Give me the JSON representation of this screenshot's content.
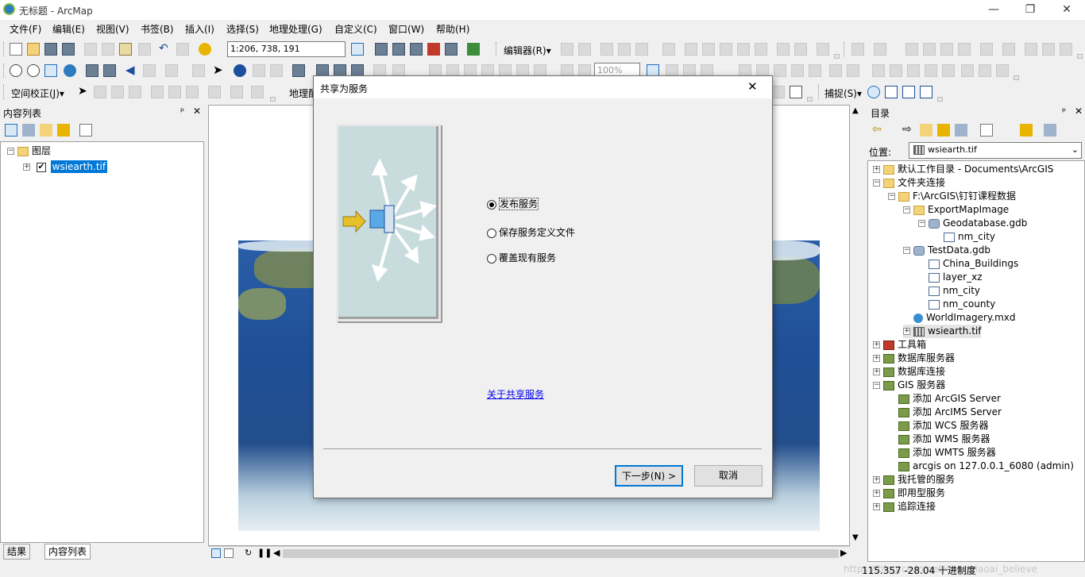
{
  "window": {
    "title": "无标题 - ArcMap",
    "minimize": "—",
    "maximize": "❐",
    "close": "✕"
  },
  "menu": [
    "文件(F)",
    "编辑(E)",
    "视图(V)",
    "书签(B)",
    "插入(I)",
    "选择(S)",
    "地理处理(G)",
    "自定义(C)",
    "窗口(W)",
    "帮助(H)"
  ],
  "toolbar": {
    "scale": "1:206, 738, 191",
    "editor_label": "编辑器(R)▾",
    "zoom_level": "100%",
    "georef_label": "空间校正(J)▾",
    "geoproc_label": "地理配",
    "snap_label": "捕捉(S)▾"
  },
  "toc": {
    "title": "内容列表",
    "pin": "ᵖ",
    "close": "✕",
    "layers_label": "图层",
    "layer_name": "wsiearth.tif",
    "tab_results": "结果",
    "tab_toc": "内容列表"
  },
  "dialog": {
    "title": "共享为服务",
    "close": "✕",
    "options": [
      {
        "label": "发布服务",
        "selected": true
      },
      {
        "label": "保存服务定义文件",
        "selected": false
      },
      {
        "label": "覆盖现有服务",
        "selected": false
      }
    ],
    "link": "关于共享服务",
    "next": "下一步(N) >",
    "cancel": "取消"
  },
  "catalog": {
    "title": "目录",
    "location_label": "位置:",
    "location_value": "wsiearth.tif",
    "tree": [
      {
        "label": "默认工作目录 - Documents\\ArcGIS",
        "icon": "folder",
        "indent": 0,
        "expander": "+"
      },
      {
        "label": "文件夹连接",
        "icon": "folder",
        "indent": 0,
        "expander": "−"
      },
      {
        "label": "F:\\ArcGIS\\钉钉课程数据",
        "icon": "folder",
        "indent": 1,
        "expander": "−"
      },
      {
        "label": "ExportMapImage",
        "icon": "folder",
        "indent": 2,
        "expander": "−"
      },
      {
        "label": "Geodatabase.gdb",
        "icon": "gdb",
        "indent": 3,
        "expander": "−"
      },
      {
        "label": "nm_city",
        "icon": "fc",
        "indent": 4,
        "expander": ""
      },
      {
        "label": "TestData.gdb",
        "icon": "gdb",
        "indent": 2,
        "expander": "−"
      },
      {
        "label": "China_Buildings",
        "icon": "fc",
        "indent": 3,
        "expander": ""
      },
      {
        "label": "layer_xz",
        "icon": "fc",
        "indent": 3,
        "expander": ""
      },
      {
        "label": "nm_city",
        "icon": "fc",
        "indent": 3,
        "expander": ""
      },
      {
        "label": "nm_county",
        "icon": "fc",
        "indent": 3,
        "expander": ""
      },
      {
        "label": "WorldImagery.mxd",
        "icon": "mxd",
        "indent": 2,
        "expander": ""
      },
      {
        "label": "wsiearth.tif",
        "icon": "tif",
        "indent": 2,
        "expander": "+"
      },
      {
        "label": "工具箱",
        "icon": "tool",
        "indent": 0,
        "expander": "+"
      },
      {
        "label": "数据库服务器",
        "icon": "srv",
        "indent": 0,
        "expander": "+"
      },
      {
        "label": "数据库连接",
        "icon": "srv",
        "indent": 0,
        "expander": "+"
      },
      {
        "label": "GIS 服务器",
        "icon": "srv",
        "indent": 0,
        "expander": "−"
      },
      {
        "label": "添加 ArcGIS Server",
        "icon": "srv",
        "indent": 1,
        "expander": ""
      },
      {
        "label": "添加 ArcIMS Server",
        "icon": "srv",
        "indent": 1,
        "expander": ""
      },
      {
        "label": "添加 WCS 服务器",
        "icon": "srv",
        "indent": 1,
        "expander": ""
      },
      {
        "label": "添加 WMS 服务器",
        "icon": "srv",
        "indent": 1,
        "expander": ""
      },
      {
        "label": "添加 WMTS 服务器",
        "icon": "srv",
        "indent": 1,
        "expander": ""
      },
      {
        "label": "arcgis on 127.0.0.1_6080 (admin)",
        "icon": "srv",
        "indent": 1,
        "expander": ""
      },
      {
        "label": "我托管的服务",
        "icon": "srv",
        "indent": 0,
        "expander": "+"
      },
      {
        "label": "即用型服务",
        "icon": "srv",
        "indent": 0,
        "expander": "+"
      },
      {
        "label": "追踪连接",
        "icon": "srv",
        "indent": 0,
        "expander": "+"
      }
    ]
  },
  "status": {
    "coords": "115.357  -28.04 十进制度",
    "watermark": "https://blog.csdn.net/dongxiaoai_believe"
  }
}
